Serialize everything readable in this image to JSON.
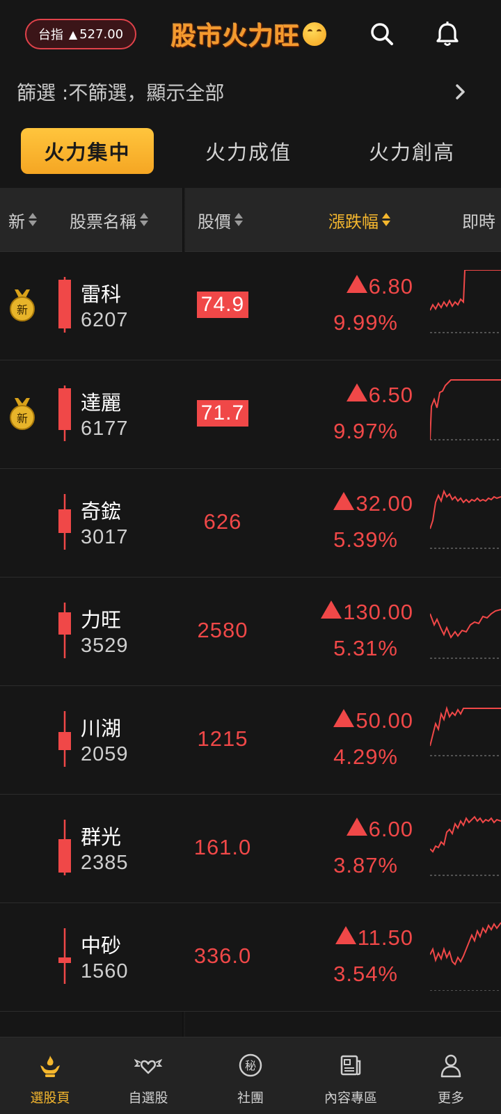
{
  "header": {
    "index_label": "台指",
    "index_value": "527.00",
    "brand": "股市火力旺"
  },
  "filter": {
    "text": "篩選 :不篩選，顯示全部"
  },
  "tabs": [
    {
      "label": "火力集中",
      "active": true
    },
    {
      "label": "火力成值",
      "active": false
    },
    {
      "label": "火力創高",
      "active": false
    }
  ],
  "columns": {
    "new": "新",
    "name": "股票名稱",
    "price": "股價",
    "change": "漲跌幅",
    "realtime": "即時"
  },
  "stocks": [
    {
      "new_badge": "新",
      "name": "雷科",
      "code": "6207",
      "price": "74.9",
      "limit_up": true,
      "change": "6.80",
      "pct": "9.99%"
    },
    {
      "new_badge": "新",
      "name": "達麗",
      "code": "6177",
      "price": "71.7",
      "limit_up": true,
      "change": "6.50",
      "pct": "9.97%"
    },
    {
      "new_badge": "",
      "name": "奇鋐",
      "code": "3017",
      "price": "626",
      "limit_up": false,
      "change": "32.00",
      "pct": "5.39%"
    },
    {
      "new_badge": "",
      "name": "力旺",
      "code": "3529",
      "price": "2580",
      "limit_up": false,
      "change": "130.00",
      "pct": "5.31%"
    },
    {
      "new_badge": "",
      "name": "川湖",
      "code": "2059",
      "price": "1215",
      "limit_up": false,
      "change": "50.00",
      "pct": "4.29%"
    },
    {
      "new_badge": "",
      "name": "群光",
      "code": "2385",
      "price": "161.0",
      "limit_up": false,
      "change": "6.00",
      "pct": "3.87%"
    },
    {
      "new_badge": "",
      "name": "中砂",
      "code": "1560",
      "price": "336.0",
      "limit_up": false,
      "change": "11.50",
      "pct": "3.54%"
    }
  ],
  "bottom_nav": [
    {
      "label": "選股頁",
      "icon": "hand-flame-icon",
      "active": true
    },
    {
      "label": "自選股",
      "icon": "winged-heart-icon",
      "active": false
    },
    {
      "label": "社團",
      "icon": "secret-badge-icon",
      "active": false
    },
    {
      "label": "內容專區",
      "icon": "newspaper-icon",
      "active": false
    },
    {
      "label": "更多",
      "icon": "person-icon",
      "active": false
    }
  ],
  "colors": {
    "up": "#f04848",
    "accent": "#f5b72e",
    "background": "#161616"
  }
}
